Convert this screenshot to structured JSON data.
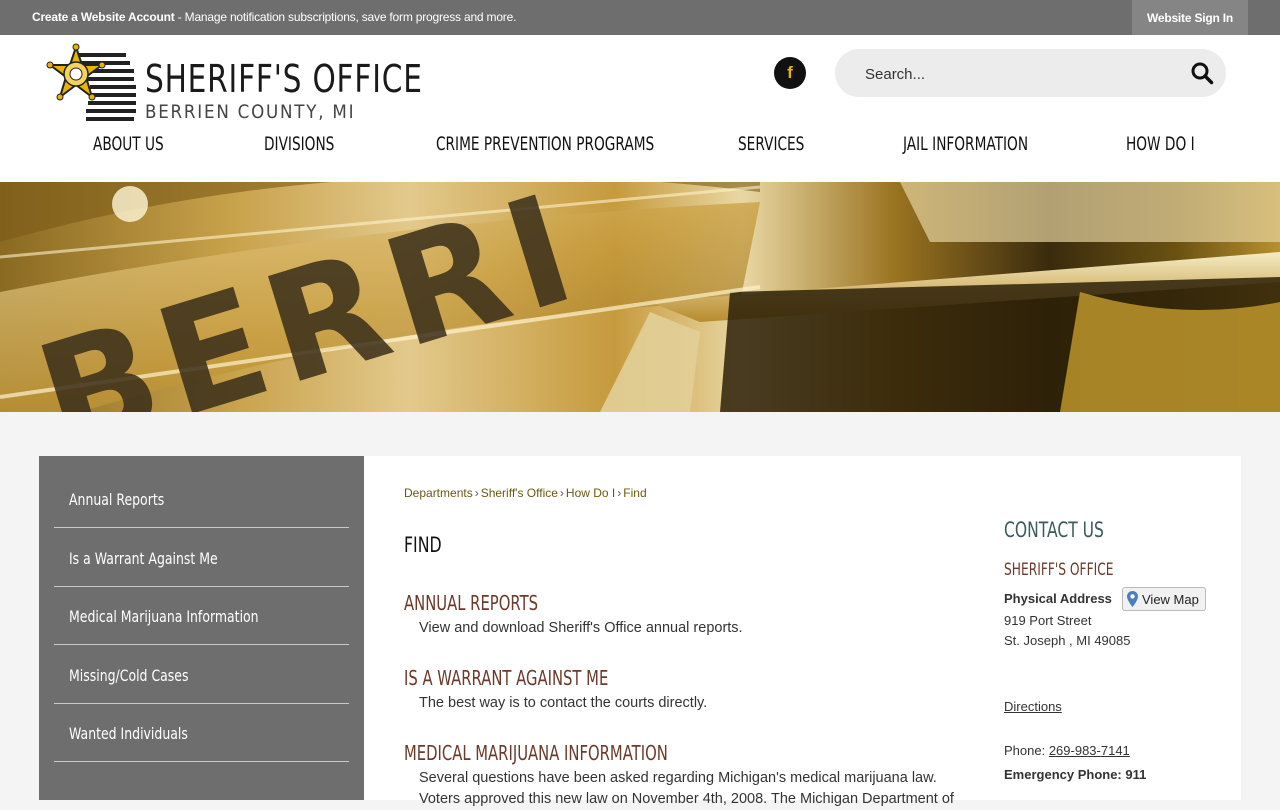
{
  "topbar": {
    "create_account": "Create a Website Account",
    "notice_rest": " - Manage notification subscriptions, save form progress and more.",
    "signin": "Website Sign In"
  },
  "logo": {
    "title": "SHERIFF'S OFFICE",
    "subtitle": "BERRIEN COUNTY, MI"
  },
  "social": {
    "icon": "facebook-icon",
    "glyph": "f"
  },
  "search": {
    "placeholder": "Search..."
  },
  "nav": [
    {
      "label": "ABOUT US"
    },
    {
      "label": "DIVISIONS"
    },
    {
      "label": "CRIME PREVENTION PROGRAMS"
    },
    {
      "label": "SERVICES"
    },
    {
      "label": "JAIL INFORMATION"
    },
    {
      "label": "HOW DO I"
    }
  ],
  "hero": {
    "text": "BERRI"
  },
  "sidebar": [
    {
      "label": "Annual Reports"
    },
    {
      "label": "Is a Warrant Against Me"
    },
    {
      "label": "Medical Marijuana Information"
    },
    {
      "label": "Missing/Cold Cases"
    },
    {
      "label": "Wanted Individuals"
    }
  ],
  "breadcrumbs": [
    "Departments",
    "Sheriff's Office",
    "How Do I",
    "Find"
  ],
  "breadcrumb_sep": "›",
  "page_title": "FIND",
  "entries": [
    {
      "title": "ANNUAL REPORTS",
      "desc": "View and download Sheriff's Office annual reports."
    },
    {
      "title": "IS A WARRANT AGAINST ME",
      "desc": "The best way is to contact the courts directly."
    },
    {
      "title": "MEDICAL MARIJUANA INFORMATION",
      "desc": "Several questions have been asked regarding Michigan's medical marijuana law. Voters approved this new law on November 4th, 2008. The Michigan Department of"
    }
  ],
  "contact": {
    "heading": "CONTACT US",
    "org": "SHERIFF'S OFFICE",
    "physical_label": "Physical Address",
    "view_map": "View Map",
    "street": "919 Port Street",
    "city": "St. Joseph , MI 49085",
    "directions": "Directions",
    "phone_label": "Phone: ",
    "phone": "269-983-7141",
    "emergency": "Emergency Phone: 911"
  },
  "colors": {
    "topbar": "#6e6e6e",
    "sidebar": "#6e6e6e",
    "heading_brown": "#6b3a2a",
    "contact_teal": "#3b5a5a",
    "breadcrumb": "#6a5a10",
    "badge_gold": "#e8b400"
  }
}
